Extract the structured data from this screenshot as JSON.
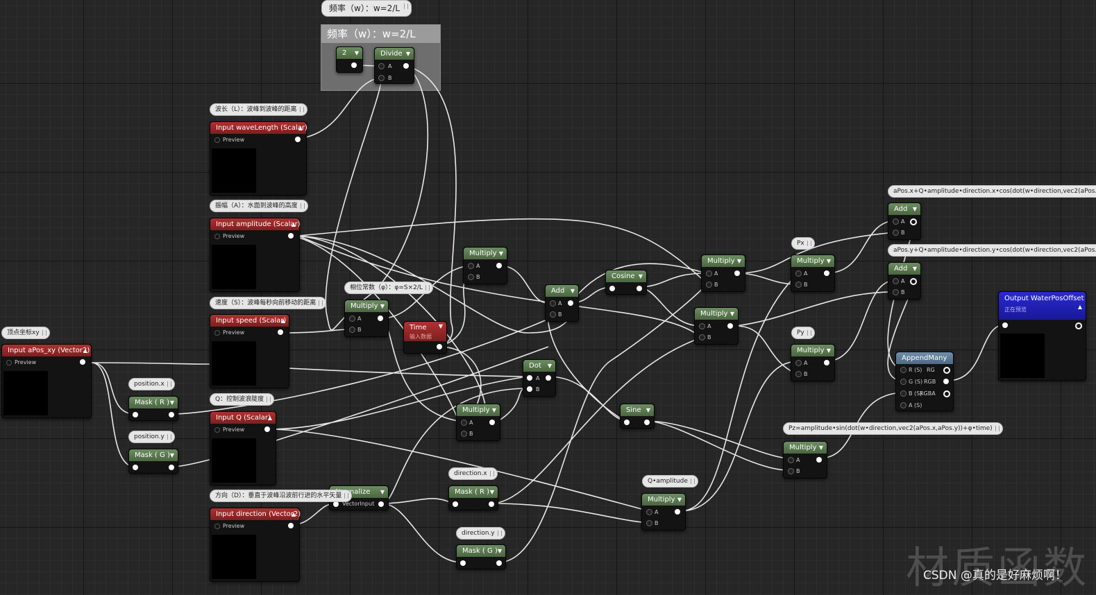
{
  "comment_box": {
    "title": "频率（w）：w=2/L"
  },
  "bubbles": {
    "freq_top": "频率（w）：w=2/L",
    "wavelength": "波长（L）：波峰到波峰的距离",
    "amplitude": "振幅（A）：水面到波峰的高度",
    "speed": "速度（S）：波峰每秒向前移动的距离",
    "phase": "相位常数（φ）：φ=S×2/L",
    "vertex": "顶点坐标xy",
    "position_x": "position.x",
    "position_y": "position.y",
    "q": "Q：控制波浪陡度",
    "direction": "方向（D）：垂直于波峰沿波前行进的水平矢量",
    "direction_x": "direction.x",
    "direction_y": "direction.y",
    "q_amplitude": "Q•amplitude",
    "px": "Px",
    "py": "Py",
    "pz": "Pz=amplitude•sin(dot(w•direction,vec2(aPos.x,aPos.y))+φ•time)",
    "ax": "aPos.x+Q•amplitude•direction.x•cos(dot(w•direction,vec2(aPos.x,aPo",
    "ay": "aPos.y+Q•amplitude•direction.y•cos(dot(w•direction,vec2(aPos.x,aPo"
  },
  "nodes": {
    "const2": {
      "title": "2"
    },
    "divide": {
      "title": "Divide",
      "a": "A",
      "b": "B"
    },
    "wavelength": {
      "title": "Input waveLength (Scalar)",
      "preview": "Preview"
    },
    "amplitude": {
      "title": "Input amplitude (Scalar)",
      "preview": "Preview"
    },
    "speed": {
      "title": "Input speed (Scalar)",
      "preview": "Preview"
    },
    "apos": {
      "title": "Input aPos_xy (Vector2)",
      "preview": "Preview"
    },
    "q": {
      "title": "Input Q (Scalar)",
      "preview": "Preview"
    },
    "direction": {
      "title": "Input direction (Vector2)",
      "preview": "Preview"
    },
    "mask_r_pos": {
      "title": "Mask ( R )"
    },
    "mask_g_pos": {
      "title": "Mask ( G )"
    },
    "mul_speed": {
      "title": "Multiply",
      "a": "A",
      "b": "B"
    },
    "time": {
      "title": "Time",
      "sub": "输入数据"
    },
    "mul_top": {
      "title": "Multiply",
      "a": "A",
      "b": "B"
    },
    "add_center": {
      "title": "Add",
      "a": "A",
      "b": "B"
    },
    "dot": {
      "title": "Dot",
      "a": "A",
      "b": "B"
    },
    "mul_mid": {
      "title": "Multiply",
      "a": "A",
      "b": "B"
    },
    "normalize": {
      "title": "Normalize",
      "in": "VectorInput"
    },
    "mask_r_dir": {
      "title": "Mask ( R )"
    },
    "mask_g_dir": {
      "title": "Mask ( G )"
    },
    "cosine": {
      "title": "Cosine"
    },
    "sine": {
      "title": "Sine"
    },
    "mul_px1": {
      "title": "Multiply",
      "a": "A",
      "b": "B"
    },
    "mul_py1": {
      "title": "Multiply",
      "a": "A",
      "b": "B"
    },
    "mul_px2": {
      "title": "Multiply",
      "a": "A",
      "b": "B"
    },
    "mul_py2": {
      "title": "Multiply",
      "a": "A",
      "b": "B"
    },
    "mul_qa": {
      "title": "Multiply",
      "a": "A",
      "b": "B"
    },
    "mul_pz": {
      "title": "Multiply",
      "a": "A",
      "b": "B"
    },
    "add_x": {
      "title": "Add",
      "a": "A",
      "b": "B"
    },
    "add_y": {
      "title": "Add",
      "a": "A",
      "b": "B"
    },
    "append": {
      "title": "AppendMany",
      "r": "R (S)",
      "g": "G (S)",
      "b": "B (S)",
      "a": "A (S)",
      "o1": "RG",
      "o2": "RGB",
      "o3": "RGBA"
    },
    "output": {
      "title": "Output WaterPosOffset",
      "sub": "正在预览"
    }
  },
  "watermark": "材质函数",
  "credit": "CSDN @真的是好麻烦啊！"
}
